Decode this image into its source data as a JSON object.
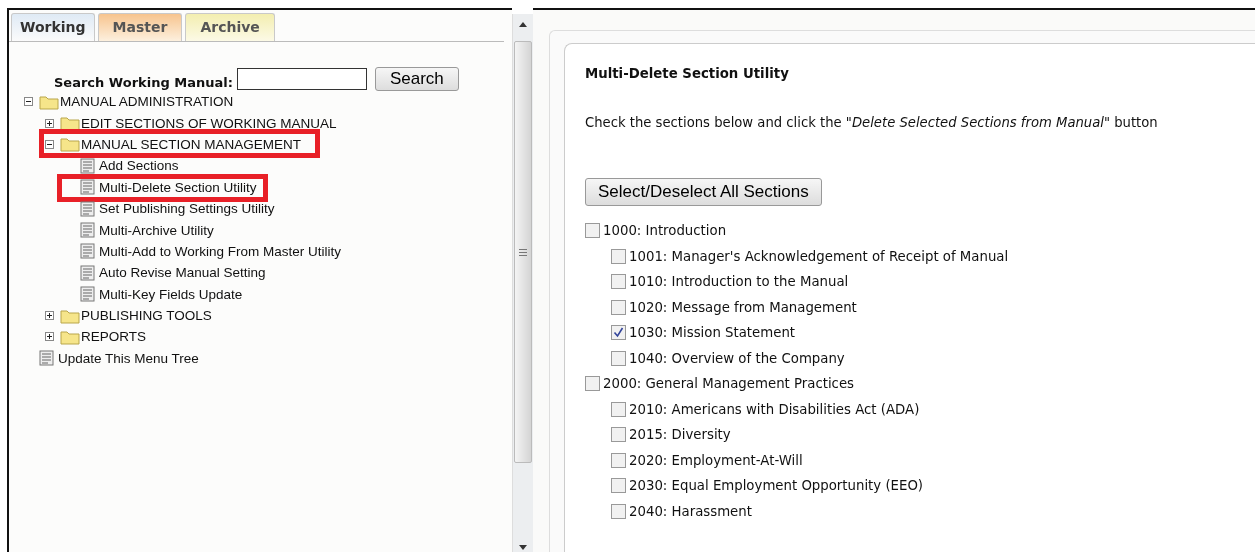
{
  "tabs": [
    {
      "label": "Working",
      "selected": true,
      "kind": "working"
    },
    {
      "label": "Master",
      "selected": false,
      "kind": "master"
    },
    {
      "label": "Archive",
      "selected": false,
      "kind": "archive"
    }
  ],
  "search": {
    "label": "Search Working Manual:",
    "button": "Search"
  },
  "tree": [
    {
      "label": "MANUAL ADMINISTRATION",
      "kind": "folder",
      "expanded": true,
      "highlighted": false,
      "children": [
        {
          "label": "EDIT SECTIONS OF WORKING MANUAL",
          "kind": "folder",
          "expanded": false,
          "highlighted": false
        },
        {
          "label": "MANUAL SECTION MANAGEMENT",
          "kind": "folder",
          "expanded": true,
          "highlighted": true,
          "children": [
            {
              "label": "Add Sections",
              "kind": "page",
              "highlighted": false
            },
            {
              "label": "Multi-Delete Section Utility",
              "kind": "page",
              "highlighted": true
            },
            {
              "label": "Set Publishing Settings Utility",
              "kind": "page",
              "highlighted": false
            },
            {
              "label": "Multi-Archive Utility",
              "kind": "page",
              "highlighted": false
            },
            {
              "label": "Multi-Add to Working From Master Utility",
              "kind": "page",
              "highlighted": false
            },
            {
              "label": "Auto Revise Manual Setting",
              "kind": "page",
              "highlighted": false
            },
            {
              "label": "Multi-Key Fields Update",
              "kind": "page",
              "highlighted": false
            }
          ]
        },
        {
          "label": "PUBLISHING TOOLS",
          "kind": "folder",
          "expanded": false,
          "highlighted": false
        },
        {
          "label": "REPORTS",
          "kind": "folder",
          "expanded": false,
          "highlighted": false
        }
      ]
    },
    {
      "label": "Update This Menu Tree",
      "kind": "page",
      "highlighted": false
    }
  ],
  "content": {
    "title": "Multi-Delete Section Utility",
    "instruction": "Check the sections below and click the *\"Delete Selected Sections from Manual\"* button",
    "select_all_button": "Select/Deselect All Sections",
    "sections": [
      {
        "label": "1000: Introduction",
        "checked": false,
        "children": [
          {
            "label": "1001: Manager's Acknowledgement of Receipt of Manual",
            "checked": false
          },
          {
            "label": "1010: Introduction to the Manual",
            "checked": false
          },
          {
            "label": "1020: Message from Management",
            "checked": false
          },
          {
            "label": "1030: Mission Statement",
            "checked": true
          },
          {
            "label": "1040: Overview of the Company",
            "checked": false
          }
        ]
      },
      {
        "label": "2000: General Management Practices",
        "checked": false,
        "children": [
          {
            "label": "2010: Americans with Disabilities Act (ADA)",
            "checked": false
          },
          {
            "label": "2015: Diversity",
            "checked": false
          },
          {
            "label": "2020: Employment-At-Will",
            "checked": false
          },
          {
            "label": "2030: Equal Employment Opportunity (EEO)",
            "checked": false
          },
          {
            "label": "2040: Harassment",
            "checked": false
          }
        ]
      }
    ]
  }
}
